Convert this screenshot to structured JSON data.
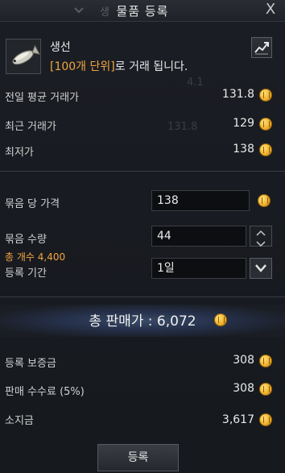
{
  "window": {
    "title": "물품 등록",
    "close_label": "X",
    "ghost_title_fragment": "생",
    "ghost_rows": [
      "4.1",
      "131.8"
    ]
  },
  "item": {
    "name": "생선",
    "unit_highlight": "[100개 단위]",
    "unit_suffix": "로 거래 됩니다."
  },
  "prices": [
    {
      "label": "전일 평균 거래가",
      "value": "131.8"
    },
    {
      "label": "최근 거래가",
      "value": "129"
    },
    {
      "label": "최저가",
      "value": "138"
    }
  ],
  "form": {
    "bundle_price_label": "묶음 당 가격",
    "bundle_price_value": "138",
    "bundle_qty_label": "묶음 수량",
    "bundle_qty_value": "44",
    "total_count_text": "총 개수 4,400",
    "period_label": "등록 기간",
    "period_value": "1일"
  },
  "total": {
    "label": "총 판매가 : 6,072"
  },
  "fees": [
    {
      "label": "등록 보증금",
      "value": "308"
    },
    {
      "label": "판매 수수료 (5%)",
      "value": "308"
    },
    {
      "label": "소지금",
      "value": "3,617"
    }
  ],
  "actions": {
    "register_label": "등록"
  },
  "colors": {
    "highlight": "#f0a540",
    "coin": "#f2b530",
    "background": "#181b21"
  },
  "icons": {
    "item": "fish-icon",
    "chart": "price-chart-icon",
    "coin": "gold-coin-icon",
    "stepper_up": "chevron-up-icon",
    "stepper_down": "chevron-down-icon",
    "dropdown": "chevron-down-icon"
  }
}
